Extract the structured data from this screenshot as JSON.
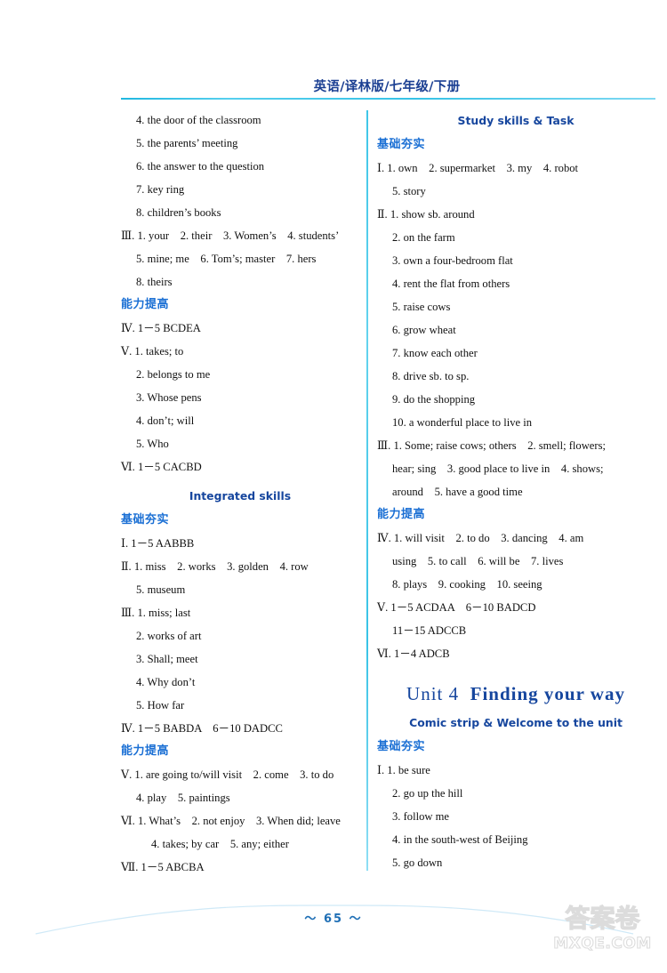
{
  "header": {
    "title": "英语/译林版/七年级/下册"
  },
  "footer": {
    "page_number": "～ 65 ～",
    "watermark_cn": "答案卷",
    "watermark_en": "MXQE.COM"
  },
  "colors": {
    "rule_cyan": "#36c2e6",
    "heading_blue": "#16469e",
    "section_blue": "#1a6fd4",
    "body_black": "#111111",
    "page_number_blue": "#1f6fb5"
  },
  "left_column": {
    "blocks": [
      {
        "kind": "answer",
        "text": "4. the door of the classroom",
        "indent": 1
      },
      {
        "kind": "answer",
        "text": "5. the parents’ meeting",
        "indent": 1
      },
      {
        "kind": "answer",
        "text": "6. the answer to the question",
        "indent": 1
      },
      {
        "kind": "answer",
        "text": "7. key ring",
        "indent": 1
      },
      {
        "kind": "answer",
        "text": "8. children’s books",
        "indent": 1
      },
      {
        "kind": "answer",
        "text": "Ⅲ. 1. your　2. their　3. Women’s　4. students’",
        "indent": 0
      },
      {
        "kind": "answer",
        "text": "5. mine; me　6. Tom’s; master　7. hers",
        "indent": 1
      },
      {
        "kind": "answer",
        "text": "8. theirs",
        "indent": 1
      },
      {
        "kind": "section_cn",
        "text": "能力提高"
      },
      {
        "kind": "answer",
        "text": "Ⅳ. 1－5 BCDEA",
        "indent": 0
      },
      {
        "kind": "answer",
        "text": "Ⅴ. 1. takes; to",
        "indent": 0
      },
      {
        "kind": "answer",
        "text": "2. belongs to me",
        "indent": 1
      },
      {
        "kind": "answer",
        "text": "3. Whose pens",
        "indent": 1
      },
      {
        "kind": "answer",
        "text": "4. don’t; will",
        "indent": 1
      },
      {
        "kind": "answer",
        "text": "5. Who",
        "indent": 1
      },
      {
        "kind": "answer",
        "text": "Ⅵ. 1－5 CACBD",
        "indent": 0
      },
      {
        "kind": "spacer_sm"
      },
      {
        "kind": "section_en",
        "text": "Integrated skills"
      },
      {
        "kind": "section_cn",
        "text": "基础夯实"
      },
      {
        "kind": "answer",
        "text": "Ⅰ. 1－5 AABBB",
        "indent": 0
      },
      {
        "kind": "answer",
        "text": "Ⅱ. 1. miss　2. works　3. golden　4. row",
        "indent": 0
      },
      {
        "kind": "answer",
        "text": "5. museum",
        "indent": 1
      },
      {
        "kind": "answer",
        "text": "Ⅲ. 1. miss; last",
        "indent": 0
      },
      {
        "kind": "answer",
        "text": "2. works of art",
        "indent": 1
      },
      {
        "kind": "answer",
        "text": "3. Shall; meet",
        "indent": 1
      },
      {
        "kind": "answer",
        "text": "4. Why don’t",
        "indent": 1
      },
      {
        "kind": "answer",
        "text": "5. How far",
        "indent": 1
      },
      {
        "kind": "answer",
        "text": "Ⅳ. 1－5 BABDA　6－10 DADCC",
        "indent": 0
      },
      {
        "kind": "section_cn",
        "text": "能力提高"
      },
      {
        "kind": "answer",
        "text": "Ⅴ. 1. are going to/will visit　2. come　3. to do",
        "indent": 0
      },
      {
        "kind": "answer",
        "text": "4. play　5. paintings",
        "indent": 1
      },
      {
        "kind": "answer",
        "text": "Ⅵ. 1. What’s　2. not enjoy　3. When did; leave",
        "indent": 0
      },
      {
        "kind": "answer",
        "text": "4. takes; by car　5. any; either",
        "indent": 2
      },
      {
        "kind": "answer",
        "text": "Ⅶ. 1－5 ABCBA",
        "indent": 0
      }
    ]
  },
  "right_column": {
    "blocks": [
      {
        "kind": "section_en",
        "text": "Study skills & Task"
      },
      {
        "kind": "section_cn",
        "text": "基础夯实"
      },
      {
        "kind": "answer",
        "text": "Ⅰ. 1. own　2. supermarket　3. my　4. robot",
        "indent": 0
      },
      {
        "kind": "answer",
        "text": "5. story",
        "indent": 1
      },
      {
        "kind": "answer",
        "text": "Ⅱ. 1. show sb. around",
        "indent": 0
      },
      {
        "kind": "answer",
        "text": "2. on the farm",
        "indent": 1
      },
      {
        "kind": "answer",
        "text": "3. own a four-bedroom flat",
        "indent": 1
      },
      {
        "kind": "answer",
        "text": "4. rent the flat from others",
        "indent": 1
      },
      {
        "kind": "answer",
        "text": "5. raise cows",
        "indent": 1
      },
      {
        "kind": "answer",
        "text": "6. grow wheat",
        "indent": 1
      },
      {
        "kind": "answer",
        "text": "7. know each other",
        "indent": 1
      },
      {
        "kind": "answer",
        "text": "8. drive sb. to sp.",
        "indent": 1
      },
      {
        "kind": "answer",
        "text": "9. do the shopping",
        "indent": 1
      },
      {
        "kind": "answer",
        "text": "10. a wonderful place to live in",
        "indent": 1
      },
      {
        "kind": "answer",
        "text": "Ⅲ. 1. Some; raise cows; others　2. smell; flowers;",
        "indent": 0
      },
      {
        "kind": "answer",
        "text": "hear; sing　3. good place to live in　4. shows;",
        "indent": 1
      },
      {
        "kind": "answer",
        "text": "around　5. have a good time",
        "indent": 1
      },
      {
        "kind": "section_cn",
        "text": "能力提高"
      },
      {
        "kind": "answer",
        "text": "Ⅳ. 1. will visit　2. to do　3. dancing　4. am",
        "indent": 0
      },
      {
        "kind": "answer",
        "text": "using　5. to call　6. will be　7. lives",
        "indent": 1
      },
      {
        "kind": "answer",
        "text": "8. plays　9. cooking　10. seeing",
        "indent": 1
      },
      {
        "kind": "answer",
        "text": "Ⅴ. 1－5 ACDAA　6－10 BADCD",
        "indent": 0
      },
      {
        "kind": "answer",
        "text": "11－15 ADCCB",
        "indent": 1
      },
      {
        "kind": "answer",
        "text": "Ⅵ. 1－4 ADCB",
        "indent": 0
      },
      {
        "kind": "spacer_md"
      },
      {
        "kind": "unit_title",
        "unit_label": "Unit 4",
        "unit_name": "Finding your way"
      },
      {
        "kind": "section_en",
        "text": "Comic strip & Welcome to the unit"
      },
      {
        "kind": "section_cn",
        "text": "基础夯实"
      },
      {
        "kind": "answer",
        "text": "Ⅰ. 1. be sure",
        "indent": 0
      },
      {
        "kind": "answer",
        "text": "2. go up the hill",
        "indent": 1
      },
      {
        "kind": "answer",
        "text": "3. follow me",
        "indent": 1
      },
      {
        "kind": "answer",
        "text": "4. in the south-west of Beijing",
        "indent": 1
      },
      {
        "kind": "answer",
        "text": "5. go down",
        "indent": 1
      }
    ]
  }
}
